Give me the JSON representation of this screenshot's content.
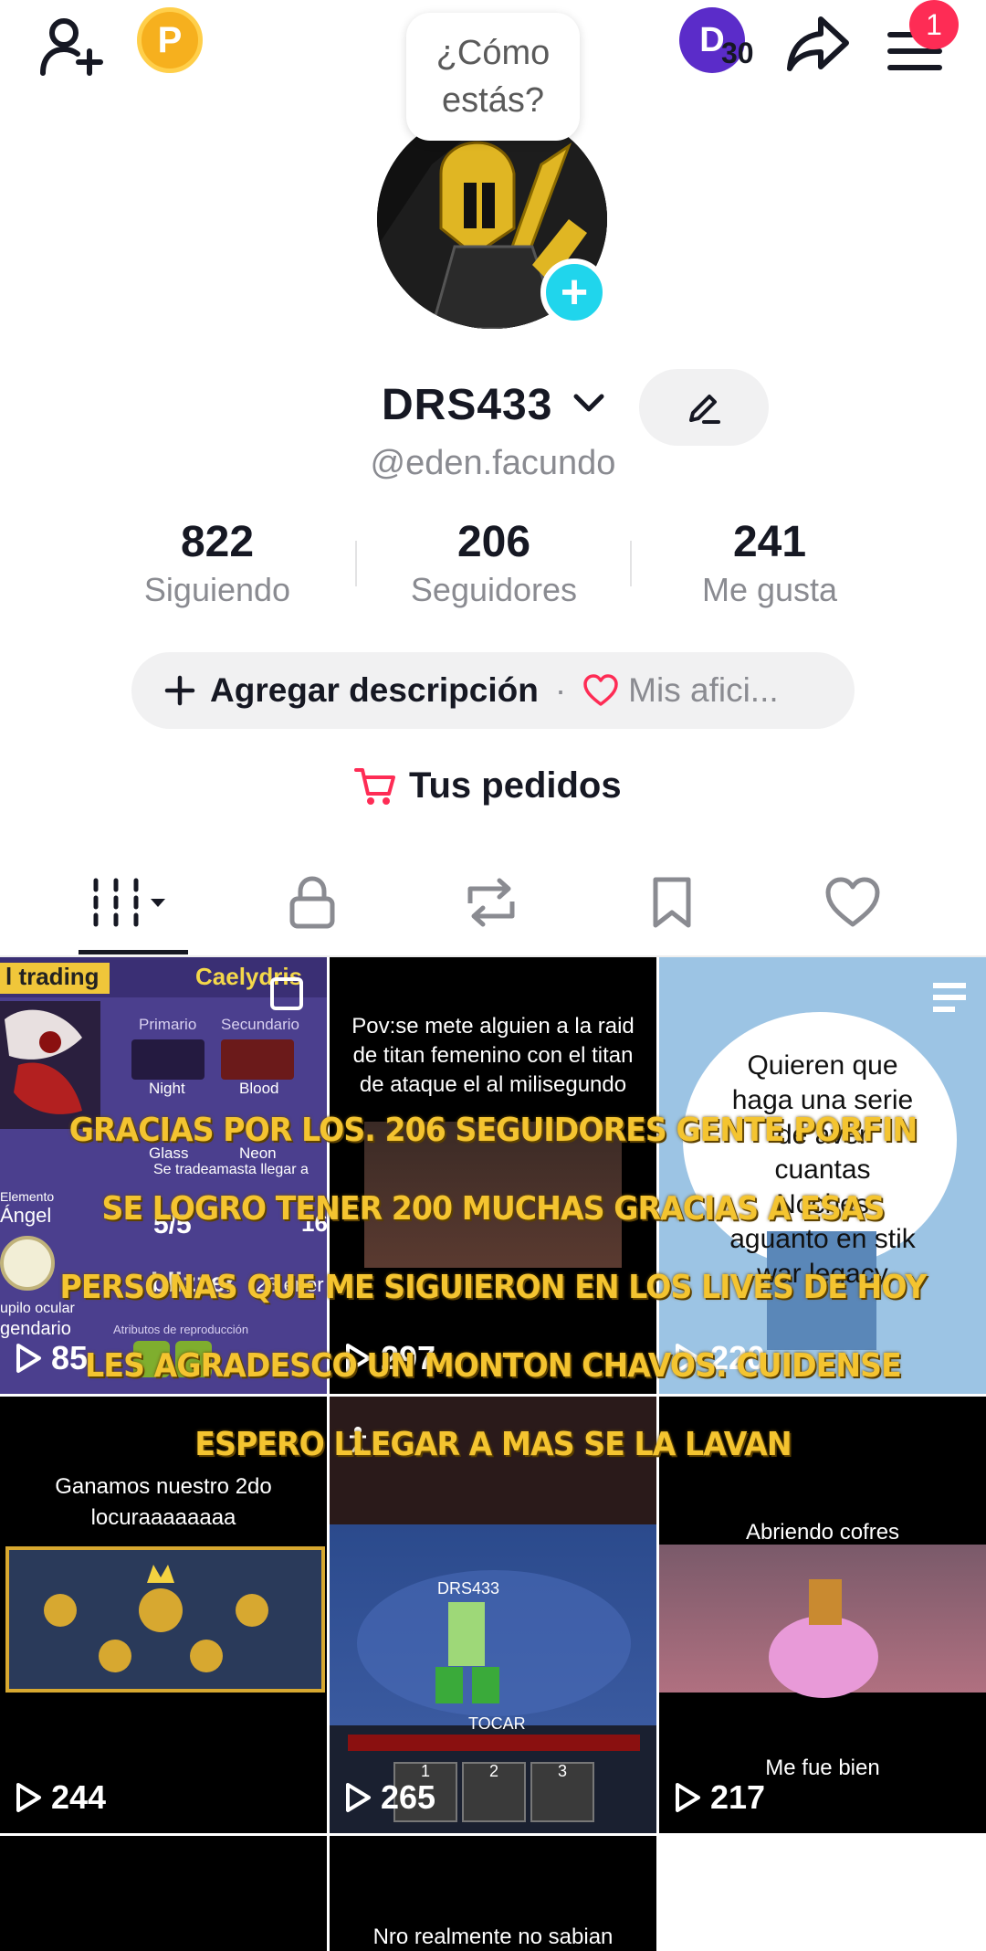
{
  "header": {
    "add_friend_icon": "add-user-icon",
    "coin_label": "P",
    "creator_badge_letter": "D",
    "creator_badge_count": "30",
    "notification_count": "1"
  },
  "profile": {
    "bubble_text_1": "¿Cómo",
    "bubble_text_2": "estás?",
    "display_name": "DRS433",
    "handle": "@eden.facundo",
    "stats": [
      {
        "value": "822",
        "label": "Siguiendo"
      },
      {
        "value": "206",
        "label": "Seguidores"
      },
      {
        "value": "241",
        "label": "Me gusta"
      }
    ],
    "add_description_label": "Agregar descripción",
    "separator": "·",
    "hobbies_label": "Mis afici...",
    "orders_label": "Tus pedidos"
  },
  "videos": [
    {
      "views": "85",
      "top_left": "l trading",
      "top_right": "Caelydris",
      "tags": [
        "Primario",
        "Secundario"
      ],
      "items": [
        "Night",
        "Blood",
        "Glass",
        "Neon"
      ],
      "line1": "Se tradeamasta llegar a",
      "mid": "5/5",
      "mid2": "16",
      "left_lbl": "Elemento",
      "angel": "Ángel",
      "name": "blizzer",
      "date": "23 ener",
      "footer": "upilo ocular",
      "footer2": "gendario",
      "footer3": "Atributos de reproducción"
    },
    {
      "views": "297",
      "line1": "Pov:se mete alguien a la raid",
      "line2": "de titan femenino con el titan",
      "line3": "de ataque el al milisegundo"
    },
    {
      "views": "220",
      "line1": "Quieren que",
      "line2": "haga una serie",
      "line3": "de aver",
      "line4": "cuantas",
      "line5": "Noches",
      "line6": "aguanto en stik",
      "line7": "war legacy"
    },
    {
      "views": "244",
      "line1": "Ganamos nuestro 2do",
      "line2": "locuraaaaaaaa"
    },
    {
      "views": "265",
      "player": "DRS433",
      "button": "TOCAR",
      "slots": [
        "1",
        "2",
        "3"
      ]
    },
    {
      "views": "217",
      "line1": "Abriendo cofres",
      "line2": "Me fue bien"
    },
    {
      "views": ""
    },
    {
      "views": "",
      "line1": "Nro realmente no sabian"
    }
  ],
  "overlay_caption": "GRACIAS POR LOS. 206 SEGUIDORES GENTE PORFIN SE LOGRO TENER 200 MUCHAS GRACIAS A ESAS PERSONAS QUE ME SIGUIERON EN LOS LIVES DE HOY LES AGRADESCO UN MONTON CHAVOS. CUIDENSE ESPERO LLEGAR A MAS SE LA LAVAN",
  "colors": {
    "accent": "#fe2c55",
    "cyan": "#20d5ec",
    "caption": "#f4c430"
  }
}
